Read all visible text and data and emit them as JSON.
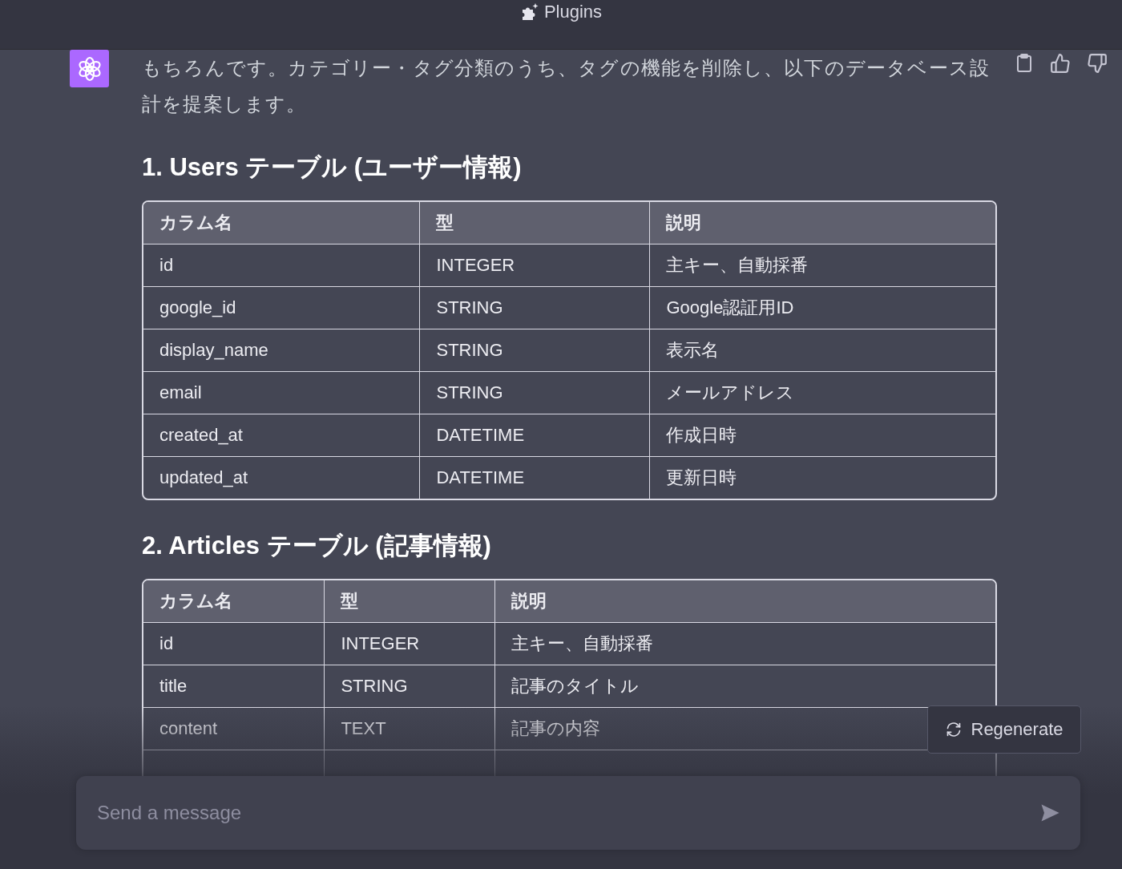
{
  "header": {
    "title": "Plugins"
  },
  "message": {
    "text": "もちろんです。カテゴリー・タグ分類のうち、タグの機能を削除し、以下のデータベース設計を提案します。",
    "sections": [
      {
        "heading": "1. Users テーブル (ユーザー情報)",
        "columns": [
          "カラム名",
          "型",
          "説明"
        ],
        "rows": [
          [
            "id",
            "INTEGER",
            "主キー、自動採番"
          ],
          [
            "google_id",
            "STRING",
            "Google認証用ID"
          ],
          [
            "display_name",
            "STRING",
            "表示名"
          ],
          [
            "email",
            "STRING",
            "メールアドレス"
          ],
          [
            "created_at",
            "DATETIME",
            "作成日時"
          ],
          [
            "updated_at",
            "DATETIME",
            "更新日時"
          ]
        ]
      },
      {
        "heading": "2. Articles テーブル (記事情報)",
        "columns": [
          "カラム名",
          "型",
          "説明"
        ],
        "rows": [
          [
            "id",
            "INTEGER",
            "主キー、自動採番"
          ],
          [
            "title",
            "STRING",
            "記事のタイトル"
          ],
          [
            "content",
            "TEXT",
            "記事の内容"
          ]
        ]
      }
    ]
  },
  "regenerate_button": "Regenerate",
  "composer": {
    "placeholder": "Send a message"
  }
}
